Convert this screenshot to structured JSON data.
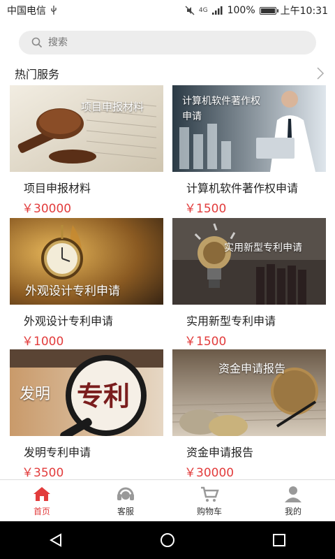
{
  "status_bar": {
    "carrier": "中国电信",
    "network_tiny": "4G",
    "battery_pct": "100%",
    "time": "上午10:31"
  },
  "search": {
    "placeholder": "搜索"
  },
  "section": {
    "title": "热门服务"
  },
  "cards": [
    {
      "thumb_title": "项目申报材料",
      "name": "项目申报材料",
      "price": "￥30000"
    },
    {
      "thumb_title_line1": "计算机软件著作权",
      "thumb_title_line2": "申请",
      "name": "计算机软件著作权申请",
      "price": "￥1500"
    },
    {
      "thumb_title": "外观设计专利申请",
      "name": "外观设计专利申请",
      "price": "￥1000"
    },
    {
      "thumb_title": "实用新型专利申请",
      "name": "实用新型专利申请",
      "price": "￥1500"
    },
    {
      "thumb_title_left": "发明",
      "thumb_title_big": "专利",
      "name": "发明专利申请",
      "price": "￥3500"
    },
    {
      "thumb_title": "资金申请报告",
      "name": "资金申请报告",
      "price": "￥30000"
    }
  ],
  "tabs": [
    {
      "label": "首页",
      "icon": "home-icon",
      "active": true
    },
    {
      "label": "客服",
      "icon": "headset-icon",
      "active": false
    },
    {
      "label": "购物车",
      "icon": "cart-icon",
      "active": false
    },
    {
      "label": "我的",
      "icon": "profile-icon",
      "active": false
    }
  ],
  "colors": {
    "accent": "#e23c3c",
    "search_bg": "#ededed"
  }
}
